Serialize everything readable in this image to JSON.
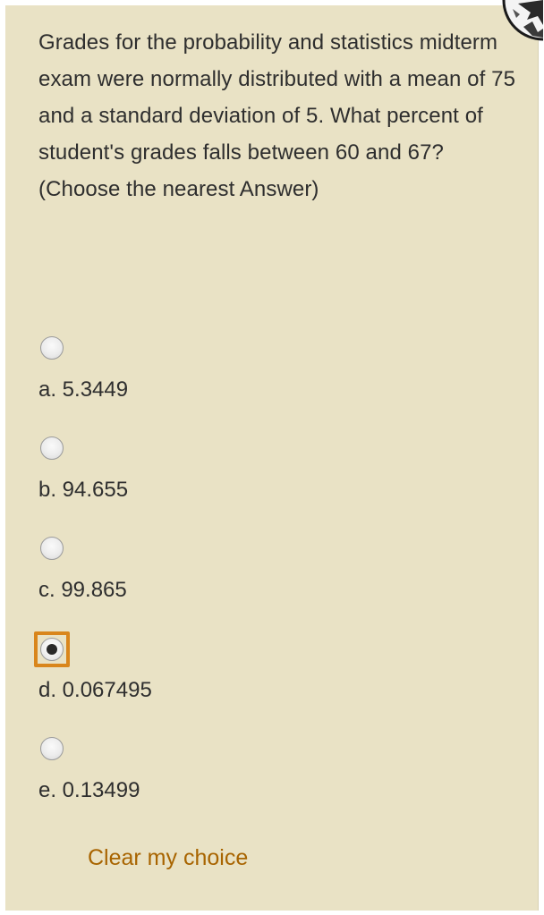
{
  "question": {
    "text": "Grades for the probability and statistics midterm exam were normally distributed with a mean of 75 and a standard deviation of 5. What percent of student's grades falls between 60 and 67? (Choose the nearest Answer)"
  },
  "options": [
    {
      "letter": "a",
      "label": "a. 5.3449",
      "selected": false
    },
    {
      "letter": "b",
      "label": "b. 94.655",
      "selected": false
    },
    {
      "letter": "c",
      "label": "c. 99.865",
      "selected": false
    },
    {
      "letter": "d",
      "label": "d. 0.067495",
      "selected": true
    },
    {
      "letter": "e",
      "label": "e. 0.13499",
      "selected": false
    }
  ],
  "actions": {
    "clear_label": "Clear my choice"
  },
  "colors": {
    "panel_background": "#e9e2c5",
    "text": "#2e2e2e",
    "link": "#a86400",
    "focus_ring": "#d9861c"
  }
}
